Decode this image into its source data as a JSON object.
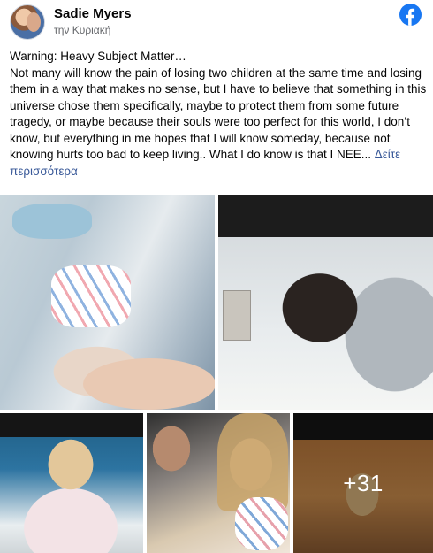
{
  "post": {
    "author": "Sadie Myers",
    "time": "την Κυριακή",
    "platform_icon": "facebook-logo-icon",
    "platform_color": "#1877f2",
    "text_first_line": "Warning: Heavy Subject Matter…",
    "text_body": "Not many will know the pain of losing two children at the same time and losing them in a way that makes no sense, but I have to believe that something in this universe chose them specifically, maybe to protect them from some future tragedy, or maybe because their souls were too perfect for this world, I don’t know, but everything in me hopes that I will know someday, because not knowing hurts too bad to keep living.. What I do know is that I NEE... ",
    "see_more": "Δείτε περισσότερα",
    "link_color": "#385898"
  },
  "photos": {
    "more_count": "+31"
  }
}
